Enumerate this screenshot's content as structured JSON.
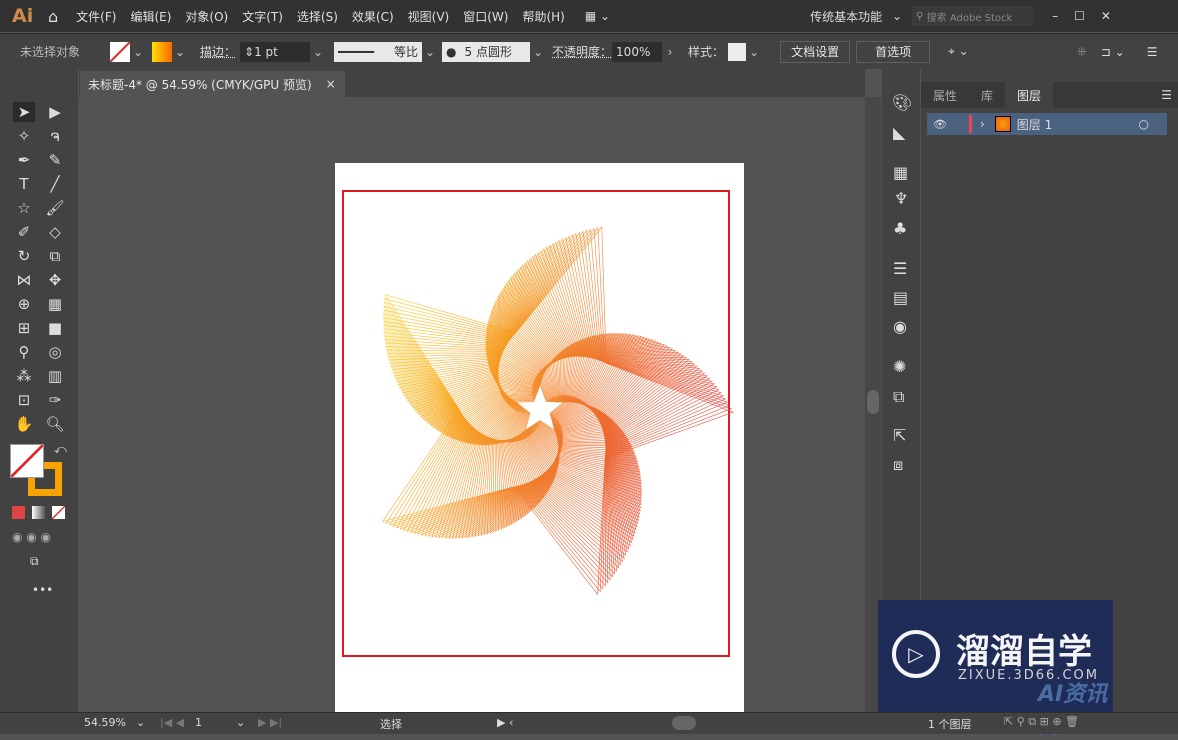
{
  "app": {
    "logo": "Ai",
    "menu": [
      "文件(F)",
      "编辑(E)",
      "对象(O)",
      "文字(T)",
      "选择(S)",
      "效果(C)",
      "视图(V)",
      "窗口(W)",
      "帮助(H)"
    ],
    "workspace": "传统基本功能",
    "search_placeholder": "搜索 Adobe Stock"
  },
  "control": {
    "selection": "未选择对象",
    "stroke_label": "描边：",
    "stroke_weight": "1 pt",
    "profile": "等比",
    "brush": "5 点圆形",
    "opacity_label": "不透明度：",
    "opacity": "100%",
    "style_label": "样式：",
    "doc_setup": "文档设置",
    "prefs": "首选项"
  },
  "document": {
    "tab_title": "未标题-4* @ 54.59% (CMYK/GPU 预览)",
    "close": "×"
  },
  "layers_panel": {
    "tabs": [
      "属性",
      "库",
      "图层"
    ],
    "active_tab": "图层",
    "layers": [
      {
        "name": "图层 1",
        "visible": true,
        "color": "#e8494f"
      }
    ],
    "count": "1 个图层"
  },
  "status": {
    "zoom": "54.59%",
    "artboard": "1",
    "tool": "选择"
  },
  "watermark": {
    "text": "溜溜自学",
    "sub": "ZIXUE.3D66.COM",
    "badge": "AI资讯网"
  },
  "colors": {
    "gradient_start": "#ffd21a",
    "gradient_end": "#e53935",
    "artboard_border": "#e0191e"
  }
}
